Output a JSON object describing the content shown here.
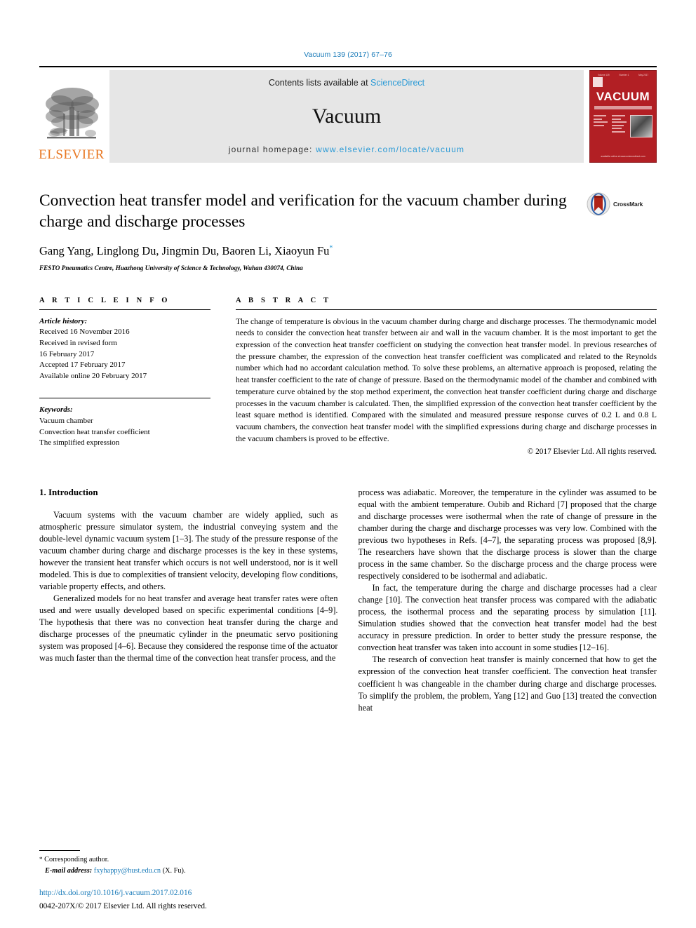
{
  "running_head": "Vacuum 139 (2017) 67–76",
  "masthead": {
    "publisher": "ELSEVIER",
    "contents_prefix": "Contents lists available at ",
    "contents_link": "ScienceDirect",
    "journal_name": "Vacuum",
    "homepage_prefix": "journal homepage: ",
    "homepage_url": "www.elsevier.com/locate/vacuum",
    "cover": {
      "title": "VACUUM",
      "top_labels": [
        "Volume 139",
        "Number 1",
        "May 2017"
      ],
      "footer": "available online at www.sciencedirect.com"
    }
  },
  "article": {
    "title": "Convection heat transfer model and verification for the vacuum chamber during charge and discharge processes",
    "authors": "Gang Yang, Linglong Du, Jingmin Du, Baoren Li, Xiaoyun Fu",
    "author_marker": "*",
    "affiliation": "FESTO Pneumatics Centre, Huazhong University of Science & Technology, Wuhan 430074, China",
    "crossmark_label": "CrossMark"
  },
  "article_info": {
    "heading": "A R T I C L E   I N F O",
    "history_label": "Article history:",
    "history": [
      "Received 16 November 2016",
      "Received in revised form",
      "16 February 2017",
      "Accepted 17 February 2017",
      "Available online 20 February 2017"
    ],
    "keywords_label": "Keywords:",
    "keywords": [
      "Vacuum chamber",
      "Convection heat transfer coefficient",
      "The simplified expression"
    ]
  },
  "abstract": {
    "heading": "A B S T R A C T",
    "text": "The change of temperature is obvious in the vacuum chamber during charge and discharge processes. The thermodynamic model needs to consider the convection heat transfer between air and wall in the vacuum chamber. It is the most important to get the expression of the convection heat transfer coefficient on studying the convection heat transfer model. In previous researches of the pressure chamber, the expression of the convection heat transfer coefficient was complicated and related to the Reynolds number which had no accordant calculation method. To solve these problems, an alternative approach is proposed, relating the heat transfer coefficient to the rate of change of pressure. Based on the thermodynamic model of the chamber and combined with temperature curve obtained by the stop method experiment, the convection heat transfer coefficient during charge and discharge processes in the vacuum chamber is calculated. Then, the simplified expression of the convection heat transfer coefficient by the least square method is identified. Compared with the simulated and measured pressure response curves of 0.2 L and 0.8 L vacuum chambers, the convection heat transfer model with the simplified expressions during charge and discharge processes in the vacuum chambers is proved to be effective.",
    "copyright": "© 2017 Elsevier Ltd. All rights reserved."
  },
  "introduction": {
    "heading": "1.  Introduction",
    "left_paragraphs": [
      "Vacuum systems with the vacuum chamber are widely applied, such as atmospheric pressure simulator system, the industrial conveying system and the double-level dynamic vacuum system [1–3]. The study of the pressure response of the vacuum chamber during charge and discharge processes is the key in these systems, however the transient heat transfer which occurs is not well understood, nor is it well modeled. This is due to complexities of transient velocity, developing flow conditions, variable property effects, and others.",
      "Generalized models for no heat transfer and average heat transfer rates were often used and were usually developed based on specific experimental conditions [4–9]. The hypothesis that there was no convection heat transfer during the charge and discharge processes of the pneumatic cylinder in the pneumatic servo positioning system was proposed [4–6]. Because they considered the response time of the actuator was much faster than the thermal time of the convection heat transfer process, and the"
    ],
    "right_paragraphs": [
      "process was adiabatic. Moreover, the temperature in the cylinder was assumed to be equal with the ambient temperature. Oubib and Richard [7] proposed that the charge and discharge processes were isothermal when the rate of change of pressure in the chamber during the charge and discharge processes was very low. Combined with the previous two hypotheses in Refs. [4–7], the separating process was proposed [8,9]. The researchers have shown that the discharge process is slower than the charge process in the same chamber. So the discharge process and the charge process were respectively considered to be isothermal and adiabatic.",
      "In fact, the temperature during the charge and discharge processes had a clear change [10]. The convection heat transfer process was compared with the adiabatic process, the isothermal process and the separating process by simulation [11]. Simulation studies showed that the convection heat transfer model had the best accuracy in pressure prediction. In order to better study the pressure response, the convection heat transfer was taken into account in some studies [12–16].",
      "The research of convection heat transfer is mainly concerned that how to get the expression of the convection heat transfer coefficient. The convection heat transfer coefficient h was changeable in the chamber during charge and discharge processes. To simplify the problem, the problem, Yang [12] and Guo [13] treated the convection heat"
    ]
  },
  "footnote": {
    "corresponding_star": "*",
    "corresponding_label": "Corresponding author.",
    "email_label": "E-mail address:",
    "email": "fxyhappy@hust.edu.cn",
    "email_suffix": "(X. Fu)."
  },
  "footer": {
    "doi": "http://dx.doi.org/10.1016/j.vacuum.2017.02.016",
    "issn_copyright": "0042-207X/© 2017 Elsevier Ltd. All rights reserved."
  },
  "colors": {
    "link_blue": "#1a7bb9",
    "sciencedirect_blue": "#2a9ad6",
    "elsevier_orange": "#E87722",
    "cover_red": "#b21f24"
  }
}
